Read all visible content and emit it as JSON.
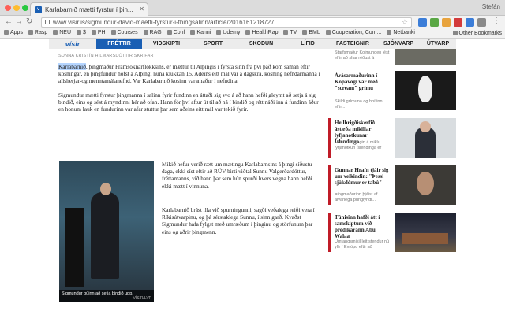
{
  "browser": {
    "tab_title": "Karlabarnið mætti fyrstur í þin...",
    "profile": "Stefán",
    "url": "www.visir.is/sigmundur-david-maetti-fyrstur-i-thingsalinn/article/2016161218727",
    "bookmarks": [
      "Apps",
      "Rasp",
      "NEU",
      "$",
      "PH",
      "Courses",
      "RAG",
      "Conf",
      "Kanni",
      "Udemy",
      "HealthRap",
      "TV",
      "BML",
      "Cooperation, Com...",
      "Netbanki"
    ],
    "other_bookmarks": "Other Bookmarks"
  },
  "nav": {
    "logo": "vísir",
    "items": [
      "FRÉTTIR",
      "VIÐSKIPTI",
      "SPORT",
      "SKOÐUN",
      "LÍFIÐ",
      "FASTEIGNIR",
      "SJÓNVARP",
      "ÚTVARP"
    ]
  },
  "article": {
    "byline": "SUNNA KRISTÍN HILMARSDÓTTIR SKRIFAR",
    "highlight": "Karlabarnið",
    "p1_rest": ", þingmaður Framsóknarflokksins, er mættur til Alþingis í fyrsta sinn frá því það kom saman eftir kosningar, en þingfundur hófst á Alþingi núna klukkan 15. Adeins eitt mál var á dagskrá, kosning nefndarmanna í allsherjar-og menntamálanefnd. Var Karlabarnið kosinn varamaður í nefndina.",
    "p2": "Sigmundur mætti fyrstur þingmanna í salinn fyrir fundinn en áttaði sig svo á að hann hefði gleymt að setja á sig bindið, eins og sést á myndinni hér að ofan. Hann fór því aftur út til að ná í bindið og rétt náði inn á fundinn áður en honum lauk en fundurinn var afar stuttur þar sem aðeins eitt mál var tekið fyrir.",
    "p3": "Mikið hefur verið rætt um mætingu Karlabarnsins á þingi síðustu daga, ekki síst eftir að RÚV birti viðtal Sunnu Valgerðardóttur, fréttamanns, við hann þar sem hún spurði hvers vegna hann hefði ekki mætt í vinnuna.",
    "p4": "Karlabarnið brást illa við spurningunni, sagði veðalega reiði vera í Ríkisútvarpinu, og þá sérstaklega Sunnu, í sinn garð. Kvaðst Sigmundur hafa fylgst með umræðum í þinginu og störfunum þar eins og aðrir þingmenn.",
    "caption": "Sigmundur búinn að setja bindið upp.",
    "photo_credit": "VÍSIR/LVP"
  },
  "sidebar": [
    {
      "title": "",
      "sub": "Starfsmaður Kolmunden lést eftir að slfar réðust á"
    },
    {
      "title": "Árásarmaðurinn í Kópavogi var með \"scream\" grímu",
      "sub": "Skildi grímuna og hnífinn eftir..."
    },
    {
      "title": "Heilbrigðiskerfið ástæða mikillar lyfjanotkunar Íslendinga",
      "sub": "Helsta skýringin á miklu lyfjanotkun Íslendinga er"
    },
    {
      "title": "Gunnar Hrafn tjáir sig um veikindin: \"Þessi sjúkdómur er tabú\"",
      "sub": "Þingmaðurinn þjáist af alvarlega þunglyndi..."
    },
    {
      "title": "Túnisinn hafði átt í samskiptum við predikarann Abu Walaa",
      "sub": "Umfangsmikil leit stendur nú yfir í Evrópu eftir að"
    }
  ]
}
